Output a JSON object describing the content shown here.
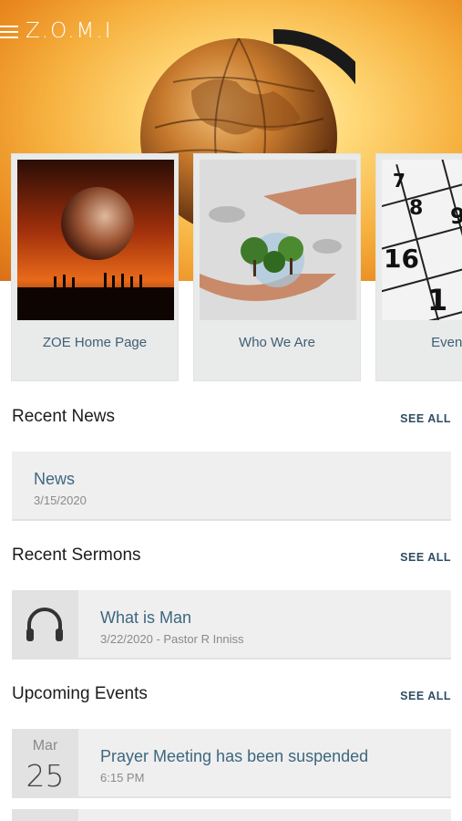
{
  "app": {
    "title": "Z.O.M.I"
  },
  "cards": [
    {
      "label": "ZOE Home Page",
      "image": "globe-sunset-image"
    },
    {
      "label": "Who We Are",
      "image": "hands-tree-image"
    },
    {
      "label": "Event Ca",
      "image": "calendar-image"
    }
  ],
  "recent_news": {
    "title": "Recent News",
    "see_all": "SEE ALL",
    "items": [
      {
        "title": "News",
        "date": "3/15/2020"
      }
    ]
  },
  "recent_sermons": {
    "title": "Recent Sermons",
    "see_all": "SEE ALL",
    "items": [
      {
        "title": "What is Man",
        "meta": "3/22/2020 - Pastor R Inniss",
        "icon": "headphones-icon"
      }
    ]
  },
  "upcoming_events": {
    "title": "Upcoming Events",
    "see_all": "SEE ALL",
    "items": [
      {
        "month": "Mar",
        "day": "25",
        "title": "Prayer Meeting has been suspended",
        "time": "6:15 PM"
      }
    ]
  },
  "colors": {
    "accent_text": "#3e6780",
    "see_all": "#2f4d63",
    "row_background": "#efefef",
    "hero_orange": "#f6b13f"
  }
}
